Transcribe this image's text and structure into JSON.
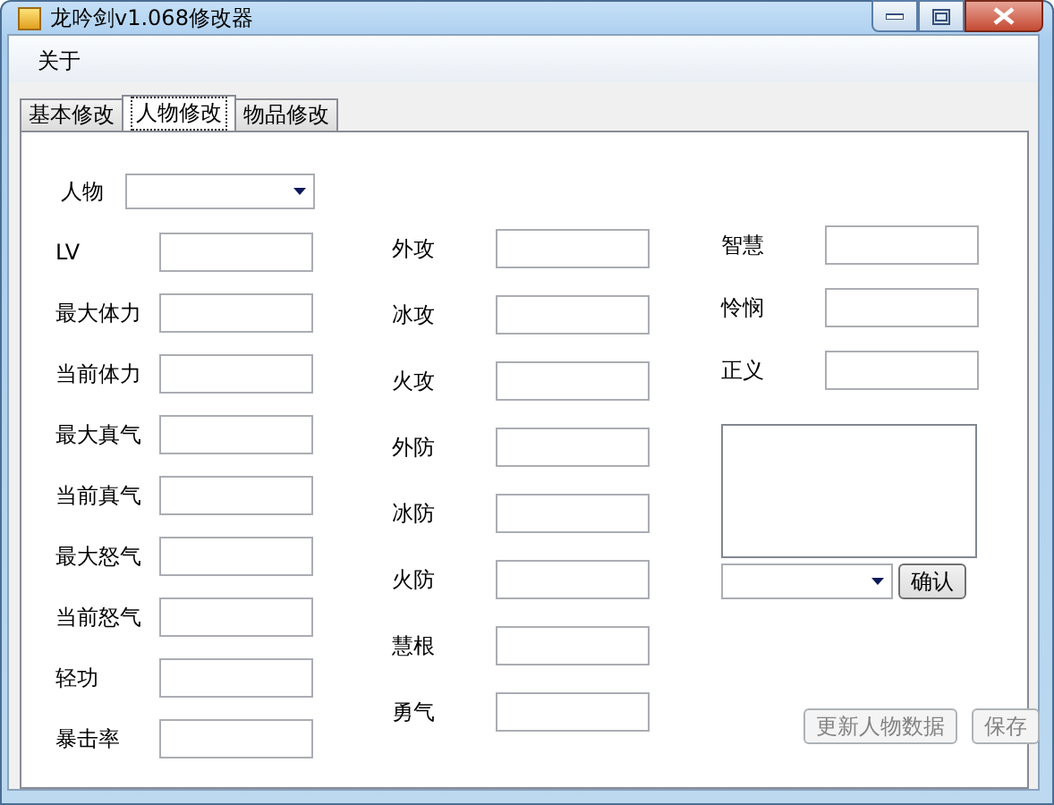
{
  "window": {
    "title": "龙吟剑v1.068修改器"
  },
  "menu": [
    {
      "label": "关于"
    }
  ],
  "tabs": [
    {
      "label": "基本修改",
      "selected": false
    },
    {
      "label": "人物修改",
      "selected": true
    },
    {
      "label": "物品修改",
      "selected": false
    }
  ],
  "character": {
    "label": "人物"
  },
  "columns": [
    [
      {
        "label": "LV"
      },
      {
        "label": "最大体力"
      },
      {
        "label": "当前体力"
      },
      {
        "label": "最大真气"
      },
      {
        "label": "当前真气"
      },
      {
        "label": "最大怒气"
      },
      {
        "label": "当前怒气"
      },
      {
        "label": "轻功"
      },
      {
        "label": "暴击率"
      }
    ],
    [
      {
        "label": "外攻"
      },
      {
        "label": "冰攻"
      },
      {
        "label": "火攻"
      },
      {
        "label": "外防"
      },
      {
        "label": "冰防"
      },
      {
        "label": "火防"
      },
      {
        "label": "慧根"
      },
      {
        "label": "勇气"
      }
    ],
    [
      {
        "label": "智慧"
      },
      {
        "label": "怜悯"
      },
      {
        "label": "正义"
      }
    ]
  ],
  "confirm_button": {
    "label": "确认",
    "disabled": false
  },
  "buttons": [
    {
      "label": "更新人物数据",
      "disabled": true
    },
    {
      "label": "保存",
      "disabled": true
    }
  ]
}
